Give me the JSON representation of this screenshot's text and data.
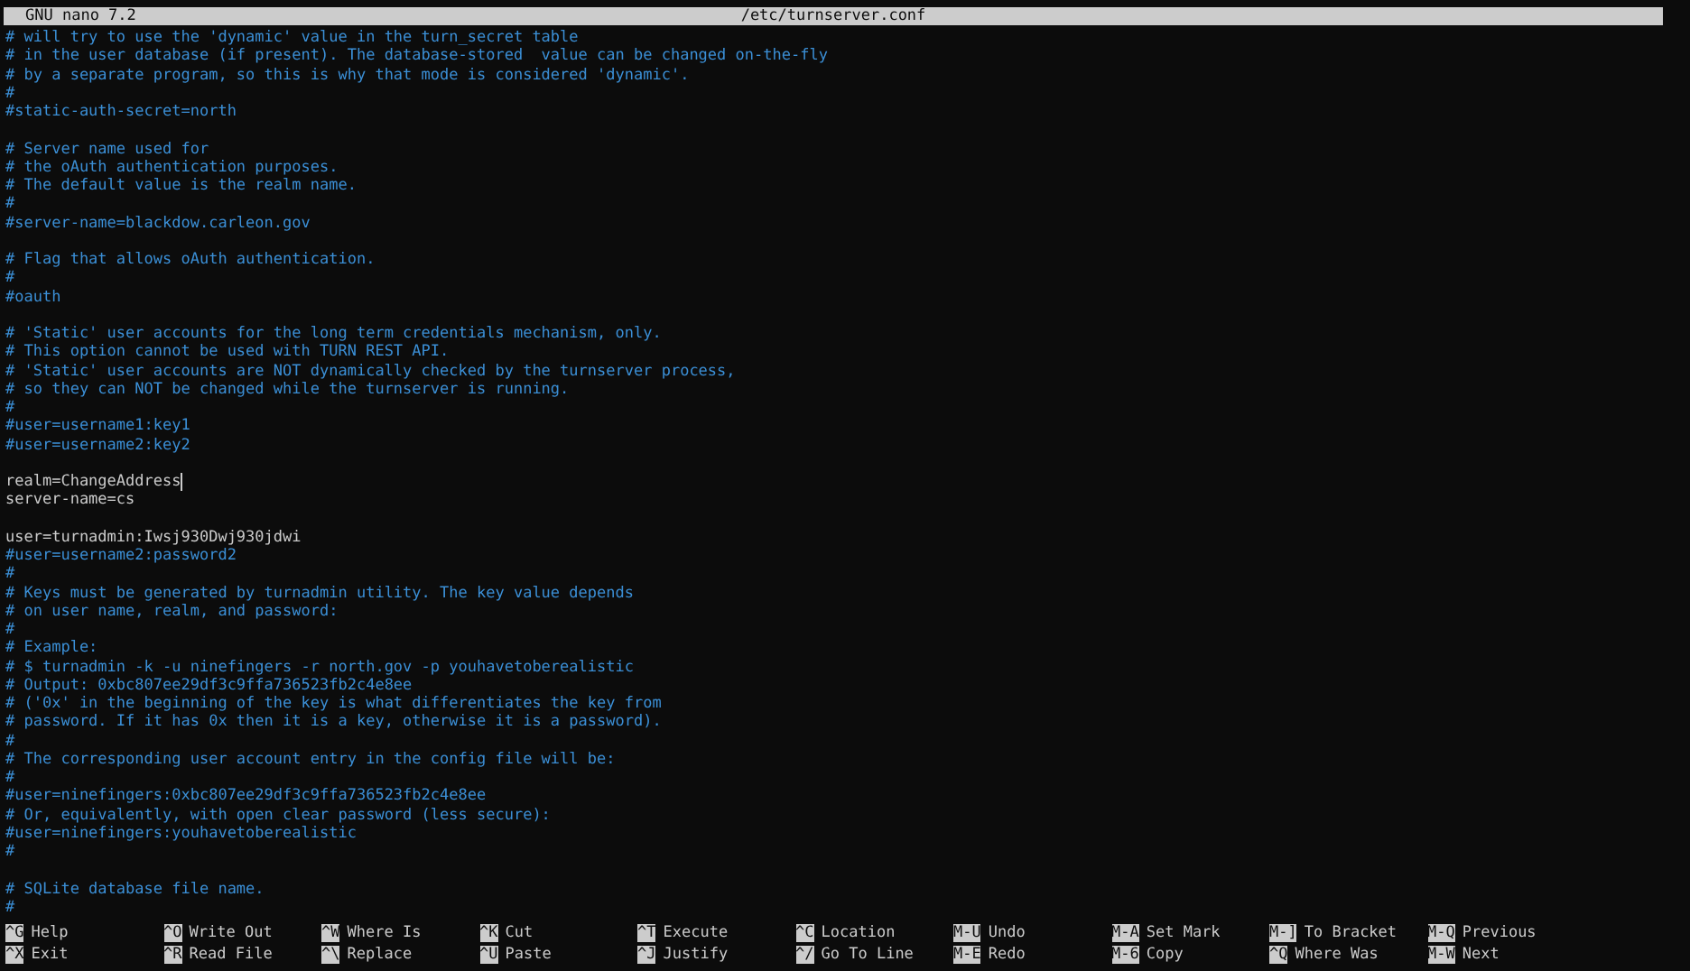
{
  "title_bar": {
    "app": "GNU nano 7.2",
    "file": "/etc/turnserver.conf"
  },
  "lines": [
    {
      "kind": "comment",
      "text": "# will try to use the 'dynamic' value in the turn_secret table"
    },
    {
      "kind": "comment",
      "text": "# in the user database (if present). The database-stored  value can be changed on-the-fly"
    },
    {
      "kind": "comment",
      "text": "# by a separate program, so this is why that mode is considered 'dynamic'."
    },
    {
      "kind": "comment",
      "text": "#"
    },
    {
      "kind": "comment",
      "text": "#static-auth-secret=north"
    },
    {
      "kind": "blank"
    },
    {
      "kind": "comment",
      "text": "# Server name used for"
    },
    {
      "kind": "comment",
      "text": "# the oAuth authentication purposes."
    },
    {
      "kind": "comment",
      "text": "# The default value is the realm name."
    },
    {
      "kind": "comment",
      "text": "#"
    },
    {
      "kind": "comment",
      "text": "#server-name=blackdow.carleon.gov"
    },
    {
      "kind": "blank"
    },
    {
      "kind": "comment",
      "text": "# Flag that allows oAuth authentication."
    },
    {
      "kind": "comment",
      "text": "#"
    },
    {
      "kind": "comment",
      "text": "#oauth"
    },
    {
      "kind": "blank"
    },
    {
      "kind": "comment",
      "text": "# 'Static' user accounts for the long term credentials mechanism, only."
    },
    {
      "kind": "comment",
      "text": "# This option cannot be used with TURN REST API."
    },
    {
      "kind": "comment",
      "text": "# 'Static' user accounts are NOT dynamically checked by the turnserver process,"
    },
    {
      "kind": "comment",
      "text": "# so they can NOT be changed while the turnserver is running."
    },
    {
      "kind": "comment",
      "text": "#"
    },
    {
      "kind": "comment",
      "text": "#user=username1:key1"
    },
    {
      "kind": "comment",
      "text": "#user=username2:key2"
    },
    {
      "kind": "blank"
    },
    {
      "kind": "setting",
      "text": "realm=ChangeAddress",
      "cursor": true
    },
    {
      "kind": "setting",
      "text": "server-name=cs"
    },
    {
      "kind": "blank"
    },
    {
      "kind": "setting",
      "text": "user=turnadmin:Iwsj930Dwj930jdwi"
    },
    {
      "kind": "comment",
      "text": "#user=username2:password2"
    },
    {
      "kind": "comment",
      "text": "#"
    },
    {
      "kind": "comment",
      "text": "# Keys must be generated by turnadmin utility. The key value depends"
    },
    {
      "kind": "comment",
      "text": "# on user name, realm, and password:"
    },
    {
      "kind": "comment",
      "text": "#"
    },
    {
      "kind": "comment",
      "text": "# Example:"
    },
    {
      "kind": "comment",
      "text": "# $ turnadmin -k -u ninefingers -r north.gov -p youhavetoberealistic"
    },
    {
      "kind": "comment",
      "text": "# Output: 0xbc807ee29df3c9ffa736523fb2c4e8ee"
    },
    {
      "kind": "comment",
      "text": "# ('0x' in the beginning of the key is what differentiates the key from"
    },
    {
      "kind": "comment",
      "text": "# password. If it has 0x then it is a key, otherwise it is a password)."
    },
    {
      "kind": "comment",
      "text": "#"
    },
    {
      "kind": "comment",
      "text": "# The corresponding user account entry in the config file will be:"
    },
    {
      "kind": "comment",
      "text": "#"
    },
    {
      "kind": "comment",
      "text": "#user=ninefingers:0xbc807ee29df3c9ffa736523fb2c4e8ee"
    },
    {
      "kind": "comment",
      "text": "# Or, equivalently, with open clear password (less secure):"
    },
    {
      "kind": "comment",
      "text": "#user=ninefingers:youhavetoberealistic"
    },
    {
      "kind": "comment",
      "text": "#"
    },
    {
      "kind": "blank"
    },
    {
      "kind": "comment",
      "text": "# SQLite database file name."
    },
    {
      "kind": "comment",
      "text": "#"
    }
  ],
  "shortcuts": [
    {
      "key": "^G",
      "label": "Help"
    },
    {
      "key": "^O",
      "label": "Write Out"
    },
    {
      "key": "^W",
      "label": "Where Is"
    },
    {
      "key": "^K",
      "label": "Cut"
    },
    {
      "key": "^T",
      "label": "Execute"
    },
    {
      "key": "^C",
      "label": "Location"
    },
    {
      "key": "M-U",
      "label": "Undo"
    },
    {
      "key": "M-A",
      "label": "Set Mark"
    },
    {
      "key": "M-]",
      "label": "To Bracket"
    },
    {
      "key": "M-Q",
      "label": "Previous"
    },
    {
      "key": "^X",
      "label": "Exit"
    },
    {
      "key": "^R",
      "label": "Read File"
    },
    {
      "key": "^\\",
      "label": "Replace"
    },
    {
      "key": "^U",
      "label": "Paste"
    },
    {
      "key": "^J",
      "label": "Justify"
    },
    {
      "key": "^/",
      "label": "Go To Line"
    },
    {
      "key": "M-E",
      "label": "Redo"
    },
    {
      "key": "M-6",
      "label": "Copy"
    },
    {
      "key": "^Q",
      "label": "Where Was"
    },
    {
      "key": "M-W",
      "label": "Next"
    }
  ]
}
